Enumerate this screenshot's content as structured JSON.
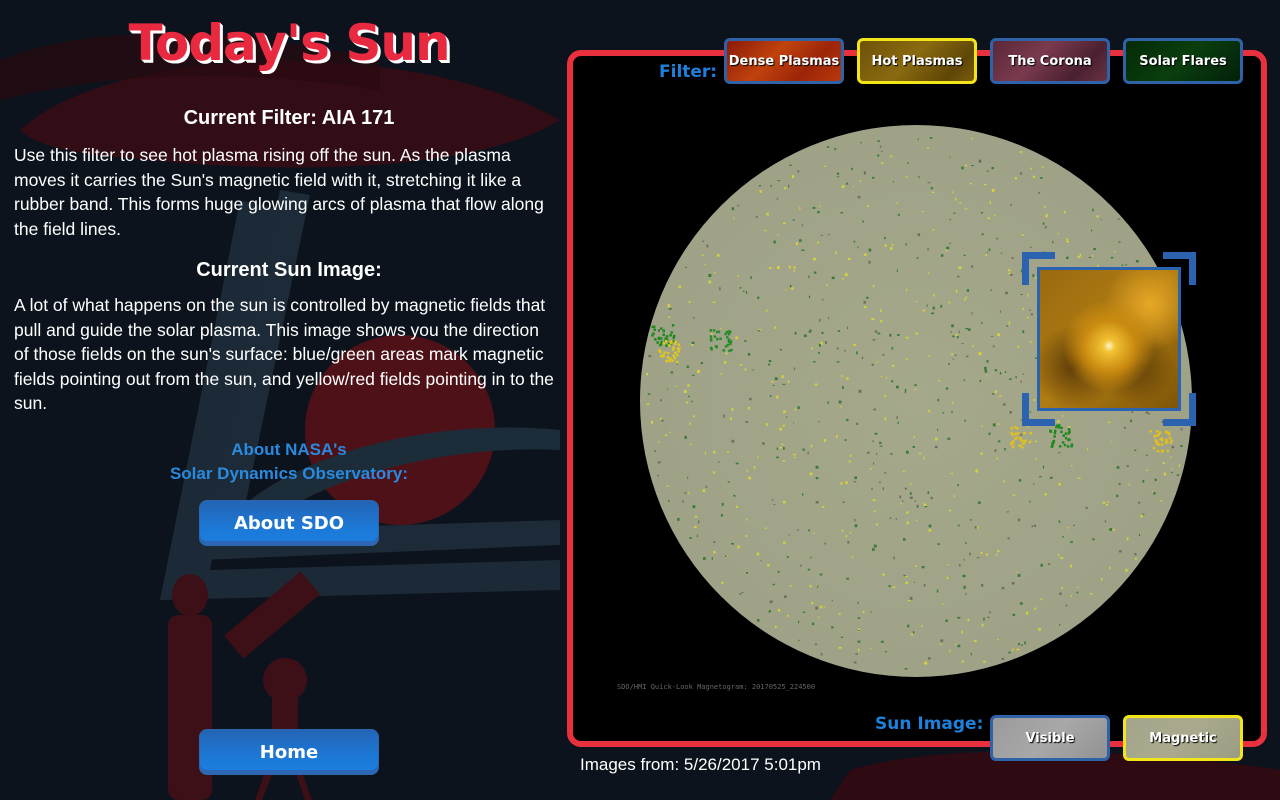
{
  "app": {
    "title": "Today's Sun"
  },
  "info": {
    "filter_heading": "Current Filter: AIA 171",
    "filter_description": "Use this filter to see hot plasma rising off the sun.  As the plasma moves it carries the Sun's magnetic field with it, stretching it like a rubber band.  This forms huge glowing arcs of plasma that flow along the field lines.",
    "sun_image_heading": "Current Sun Image:",
    "sun_image_description": "A lot of what happens on the sun is controlled by magnetic fields that pull and guide the solar plasma. This image shows you the direction of those fields on the sun's surface: blue/green areas mark magnetic fields pointing out from the sun, and yellow/red fields pointing in to the sun.",
    "about_line1": "About NASA's",
    "about_line2": "Solar Dynamics Observatory:",
    "about_button": "About SDO",
    "home_button": "Home"
  },
  "viewer": {
    "filter_label": "Filter:",
    "filters": [
      {
        "label": "Dense Plasmas",
        "selected": false
      },
      {
        "label": "Hot Plasmas",
        "selected": true
      },
      {
        "label": "The Corona",
        "selected": false
      },
      {
        "label": "Solar Flares",
        "selected": false
      }
    ],
    "sun_image_label": "Sun Image:",
    "sun_images": [
      {
        "label": "Visible",
        "selected": false
      },
      {
        "label": "Magnetic",
        "selected": true
      }
    ],
    "image_caption": "SDO/HMI Quick-Look Magnetogram: 20170525_224500",
    "images_from": "Images from: 5/26/2017 5:01pm"
  },
  "colors": {
    "accent_red": "#e8303f",
    "accent_blue": "#1e80dc",
    "selected_border": "#f2e519",
    "button_border": "#2f62a6"
  }
}
